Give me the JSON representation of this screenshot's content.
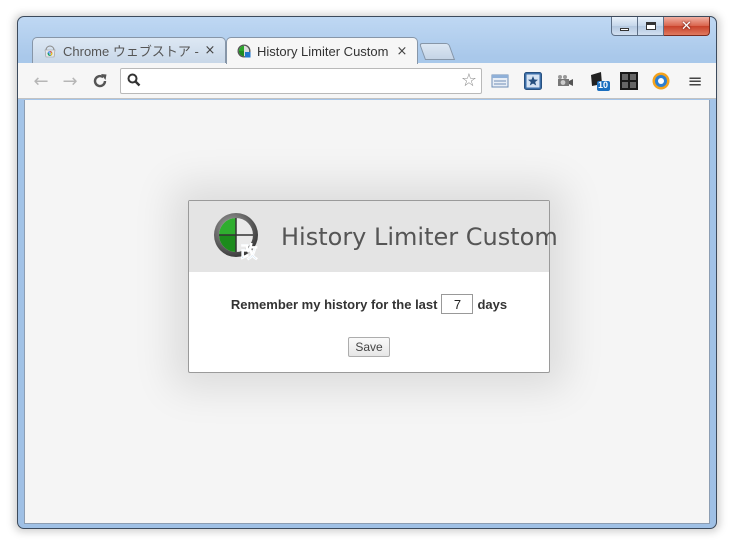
{
  "window": {
    "min_label": "",
    "colors": {
      "frame": "#a9c8ea",
      "close": "#c8412a"
    }
  },
  "tabs": [
    {
      "title": "Chrome ウェブストア - |",
      "close": "×",
      "icon": "chrome-webstore-icon",
      "active": false
    },
    {
      "title": "History Limiter Custom",
      "close": "×",
      "icon": "history-limiter-icon",
      "active": true
    }
  ],
  "toolbar": {
    "back": "←",
    "forward": "→",
    "reload": "C",
    "omnibox_value": "",
    "bookmark_star": "☆",
    "menu": "≡",
    "extensions": [
      "panel-icon",
      "bookmark-manager-icon",
      "camera-icon",
      "badge-counter-icon",
      "grid-icon",
      "gear-extension-icon"
    ],
    "badge_count": "10"
  },
  "dialog": {
    "title": "History Limiter Custom",
    "label_before": "Remember my history for the last",
    "days_value": "7",
    "label_after": "days",
    "save_label": "Save",
    "logo_badge": "改"
  }
}
